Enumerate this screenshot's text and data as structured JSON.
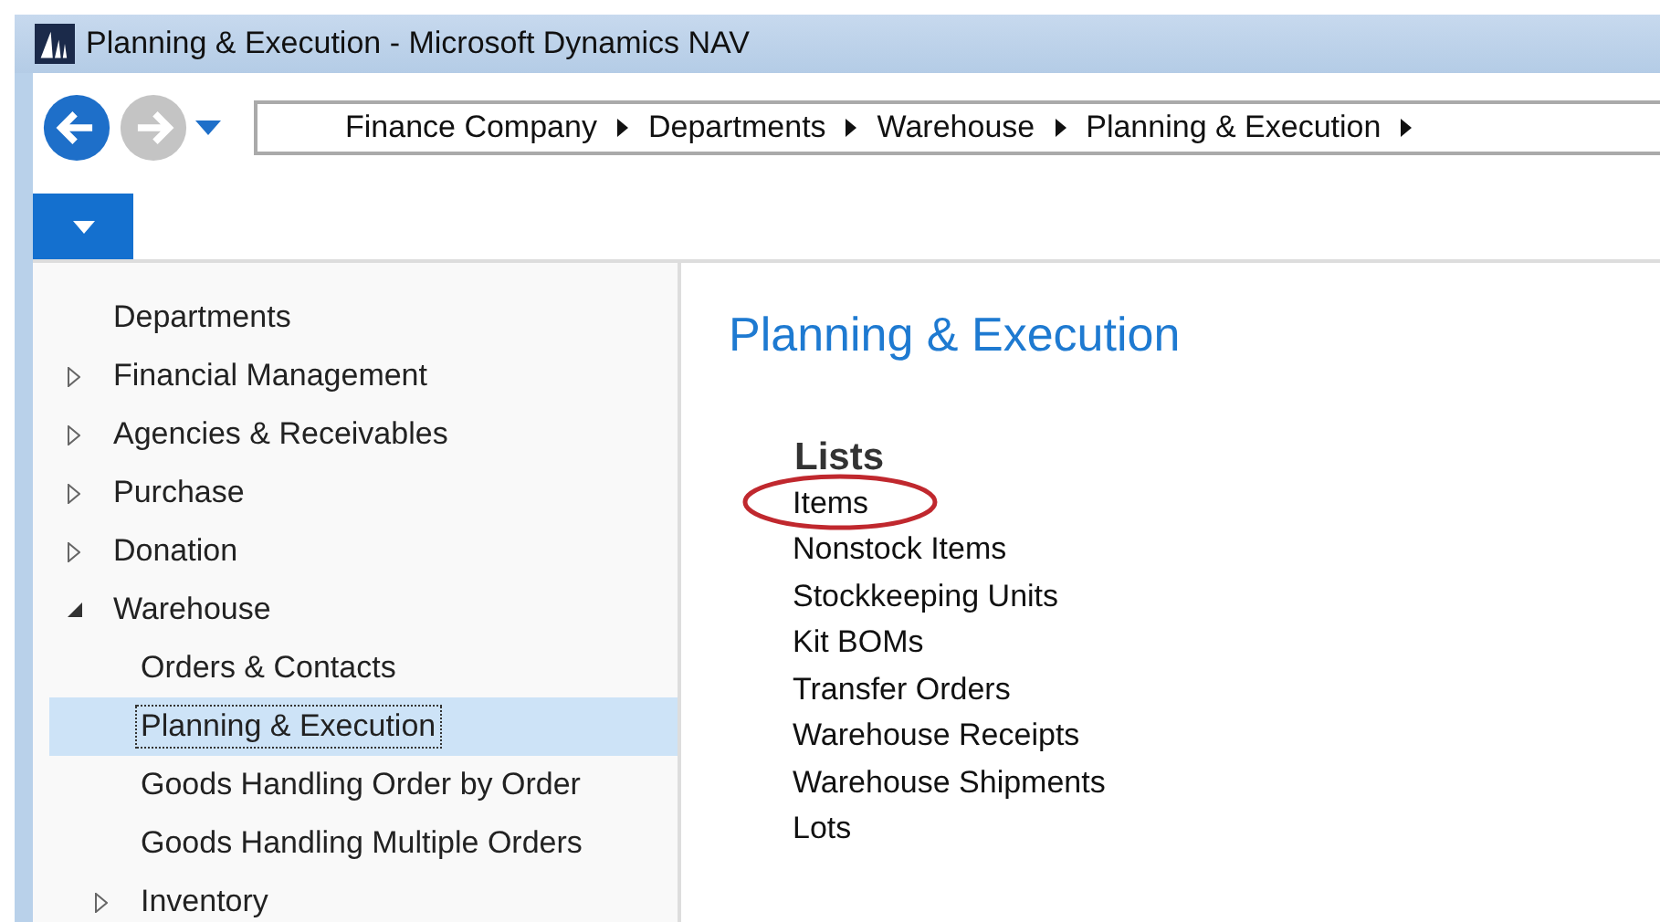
{
  "window": {
    "title": "Planning & Execution - Microsoft Dynamics NAV"
  },
  "breadcrumb": [
    "Finance Company",
    "Departments",
    "Warehouse",
    "Planning & Execution"
  ],
  "sidebar": {
    "items": [
      {
        "label": "Departments",
        "selected": false
      },
      {
        "label": "Financial Management",
        "expanded": false,
        "selected": false
      },
      {
        "label": "Agencies & Receivables",
        "expanded": false,
        "selected": false
      },
      {
        "label": "Purchase",
        "expanded": false,
        "selected": false
      },
      {
        "label": "Donation",
        "expanded": false,
        "selected": false
      },
      {
        "label": "Warehouse",
        "expanded": true,
        "selected": false,
        "children": [
          {
            "label": "Orders & Contacts",
            "selected": false
          },
          {
            "label": "Planning & Execution",
            "selected": true
          },
          {
            "label": "Goods Handling Order by Order",
            "selected": false
          },
          {
            "label": "Goods Handling Multiple Orders",
            "selected": false
          },
          {
            "label": "Inventory",
            "expanded": false,
            "selected": false
          }
        ]
      }
    ]
  },
  "page": {
    "title": "Planning & Execution",
    "section": "Lists",
    "links": [
      {
        "label": "Items",
        "highlighted": true
      },
      {
        "label": "Nonstock Items",
        "highlighted": false
      },
      {
        "label": "Stockkeeping Units",
        "highlighted": false
      },
      {
        "label": "Kit BOMs",
        "highlighted": false
      },
      {
        "label": "Transfer Orders",
        "highlighted": false
      },
      {
        "label": "Warehouse Receipts",
        "highlighted": false
      },
      {
        "label": "Warehouse Shipments",
        "highlighted": false
      },
      {
        "label": "Lots",
        "highlighted": false
      }
    ]
  }
}
